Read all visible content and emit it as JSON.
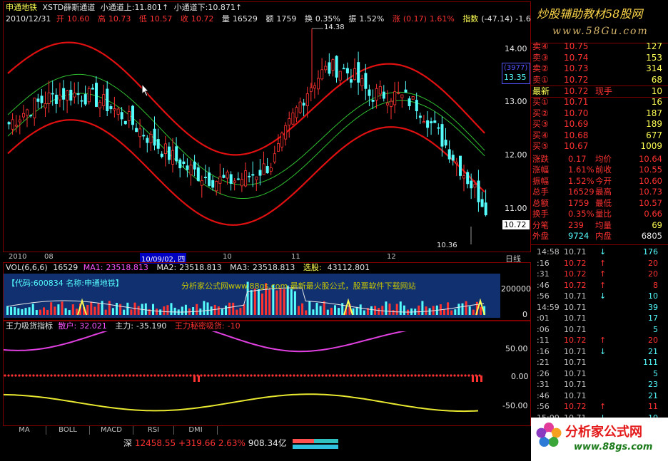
{
  "header": {
    "stock_name": "申通地铁",
    "indicator_title": "XSTD薛斯通道",
    "upper_label": "小通道上:",
    "upper_value": "11.801",
    "lower_label": "小通道下:",
    "lower_value": "10.871",
    "up_arrow": "↑",
    "date": "2010/12/31",
    "open_label": "开",
    "open": "10.60",
    "high_label": "高",
    "high": "10.73",
    "low_label": "低",
    "low": "10.57",
    "close_label": "收",
    "close": "10.72",
    "vol_label": "量",
    "vol": "16529",
    "amt_label": "额",
    "amt": "1759",
    "turn_label": "换",
    "turn": "0.35%",
    "amp_label": "振",
    "amp": "1.52%",
    "chg_label": "涨",
    "chg": "(0.17)",
    "chg_pct": "1.61%",
    "index_label": "指数",
    "index_val": "(-47.14)",
    "index_pct": "-1.65%"
  },
  "price_axis": {
    "ticks": [
      "14.00",
      "13.00",
      "12.00",
      "11.00"
    ],
    "current_box": "(3977)",
    "current_price": "13.35",
    "last_price": "10.72",
    "peak_label": "14.38",
    "trough_label": "10.36"
  },
  "time_axis": {
    "labels": [
      "2010",
      "08",
      "10",
      "11",
      "12"
    ],
    "cursor_date": "10/09/02, 四",
    "period_button": "日线"
  },
  "volume_header": {
    "label": "VOL(6,6,6)",
    "vol": "16529",
    "ma1_label": "MA1:",
    "ma1": "23518.813",
    "ma2_label": "MA2:",
    "ma2": "23518.813",
    "ma3_label": "MA3:",
    "ma3": "23518.813",
    "sel_label": "选股:",
    "sel": "43112.801",
    "code_text": "【代码:600834  名称:申通地铁】",
    "watermark": "分析家公式网www.88gs.com  最新最火股公式，股票软件下载网站",
    "axis_top": "200000",
    "axis_bottom": "0"
  },
  "indicator_header": {
    "title": "王力吸货指标",
    "retail_label": "散户:",
    "retail": "32.021",
    "main_label": "主力:",
    "main": "-35.190",
    "secret_label": "王力秘密吸货:",
    "secret": "-10",
    "axis": [
      "50.00",
      "0.00",
      "-50.00"
    ]
  },
  "tabs": [
    "MA",
    "BOLL",
    "MACD",
    "RSI",
    "DMI"
  ],
  "banner": {
    "title": "炒股辅助教材58股网",
    "url": "www.58Gu.com"
  },
  "order_book": {
    "asks": [
      {
        "label": "卖④",
        "price": "10.75",
        "vol": "127"
      },
      {
        "label": "卖③",
        "price": "10.74",
        "vol": "153"
      },
      {
        "label": "卖②",
        "price": "10.73",
        "vol": "314"
      },
      {
        "label": "卖①",
        "price": "10.72",
        "vol": "68"
      }
    ],
    "latest_label": "最新",
    "latest": "10.72",
    "now_label": "现手",
    "now_vol": "10",
    "bids": [
      {
        "label": "买①",
        "price": "10.71",
        "vol": "16"
      },
      {
        "label": "买②",
        "price": "10.70",
        "vol": "187"
      },
      {
        "label": "买③",
        "price": "10.69",
        "vol": "189"
      },
      {
        "label": "买④",
        "price": "10.68",
        "vol": "677"
      },
      {
        "label": "买⑤",
        "price": "10.67",
        "vol": "1009"
      }
    ]
  },
  "stats": [
    {
      "l1": "涨跌",
      "v1": "0.17",
      "l2": "均价",
      "v2": "10.64"
    },
    {
      "l1": "涨幅",
      "v1": "1.61%",
      "l2": "前收",
      "v2": "10.55"
    },
    {
      "l1": "振幅",
      "v1": "1.52%",
      "l2": "今开",
      "v2": "10.60"
    },
    {
      "l1": "总手",
      "v1": "16529",
      "l2": "最高",
      "v2": "10.73"
    },
    {
      "l1": "总额",
      "v1": "1759",
      "l2": "最低",
      "v2": "10.57"
    },
    {
      "l1": "换手",
      "v1": "0.35%",
      "l2": "量比",
      "v2": "0.66"
    },
    {
      "l1": "分笔",
      "v1": "239",
      "l2": "均量",
      "v2": "69"
    },
    {
      "l1": "外盘",
      "v1": "9724",
      "l2": "内盘",
      "v2": "6805"
    }
  ],
  "ticks": [
    {
      "t": "14:58",
      "p": "10.71",
      "d": "down",
      "v": "176"
    },
    {
      "t": ":16",
      "p": "10.72",
      "d": "up",
      "v": "20"
    },
    {
      "t": ":31",
      "p": "10.72",
      "d": "up",
      "v": "20"
    },
    {
      "t": ":46",
      "p": "10.72",
      "d": "up",
      "v": "8"
    },
    {
      "t": ":56",
      "p": "10.71",
      "d": "down",
      "v": "10"
    },
    {
      "t": "14:59",
      "p": "10.71",
      "d": "",
      "v": "39"
    },
    {
      "t": ":01",
      "p": "10.71",
      "d": "",
      "v": "17"
    },
    {
      "t": ":06",
      "p": "10.71",
      "d": "",
      "v": "5"
    },
    {
      "t": ":11",
      "p": "10.72",
      "d": "up",
      "v": "20"
    },
    {
      "t": ":16",
      "p": "10.71",
      "d": "down",
      "v": "21"
    },
    {
      "t": ":21",
      "p": "10.71",
      "d": "",
      "v": "111"
    },
    {
      "t": ":26",
      "p": "10.71",
      "d": "",
      "v": "5"
    },
    {
      "t": ":31",
      "p": "10.71",
      "d": "",
      "v": "23"
    },
    {
      "t": ":46",
      "p": "10.71",
      "d": "",
      "v": "21"
    },
    {
      "t": ":56",
      "p": "10.72",
      "d": "up",
      "v": "11"
    },
    {
      "t": "15:00",
      "p": "10.71",
      "d": "down",
      "v": "10"
    }
  ],
  "index_bar": {
    "label": "深",
    "value": "12458.55",
    "change": "+319.66",
    "pct": "2.63%",
    "amount": "908.34亿"
  },
  "logo": {
    "title": "分析家公式网",
    "url": "www.88gs.com"
  },
  "colors": {
    "up": "#ff3232",
    "down": "#54fcfc",
    "channel_outer": "#e01010",
    "channel_inner": "#30c030",
    "retail_line": "#e040e0",
    "main_line": "#e8e830",
    "border": "#800000"
  }
}
